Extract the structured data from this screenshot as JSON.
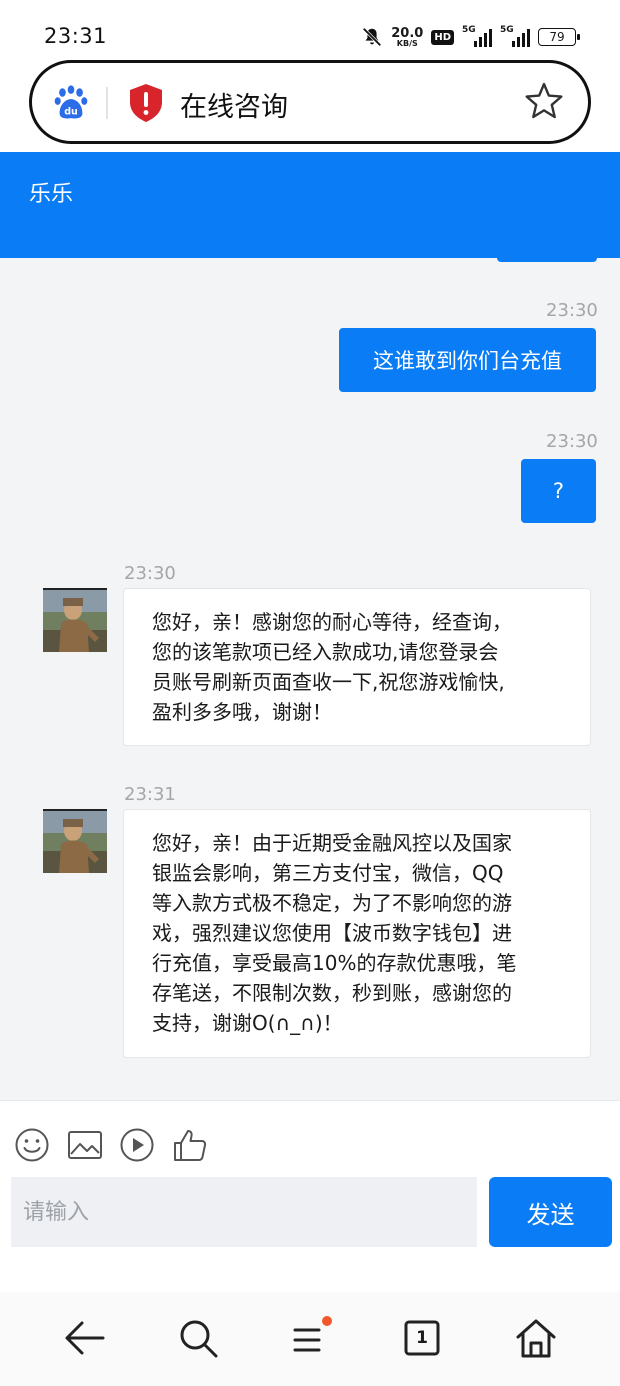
{
  "status_bar": {
    "time": "23:31",
    "net_speed": "20.0",
    "net_unit": "KB/S",
    "hd_label": "HD",
    "sig1": "5G",
    "sig2": "5G",
    "battery": "79"
  },
  "address_bar": {
    "title": "在线咨询"
  },
  "chat": {
    "title": "乐乐"
  },
  "messages": [
    {
      "side": "out",
      "time": "23:30",
      "text": "这谁敢到你们台充值"
    },
    {
      "side": "out",
      "time": "23:30",
      "text": "?"
    },
    {
      "side": "in",
      "time": "23:30",
      "lines": [
        "您好，亲！感谢您的耐心等待，经查询，",
        "您的该笔款项已经入款成功,请您登录会",
        "员账号刷新页面查收一下,祝您游戏愉快,",
        "盈利多多哦，谢谢！"
      ]
    },
    {
      "side": "in",
      "time": "23:31",
      "lines": [
        "您好，亲！由于近期受金融风控以及国家",
        "银监会影响，第三方支付宝，微信，QQ",
        "等入款方式极不稳定，为了不影响您的游",
        "戏，强烈建议您使用【波币数字钱包】进",
        "行充值，享受最高10%的存款优惠哦，笔",
        "存笔送，不限制次数，秒到账，感谢您的",
        "支持，谢谢O(∩_∩)！"
      ]
    }
  ],
  "input": {
    "placeholder": "请输入",
    "send_label": "发送"
  },
  "bottom_nav": {
    "tab_count": "1"
  },
  "colors": {
    "accent": "#0a7cf5",
    "badge": "#f2572b",
    "shield": "#d7252b"
  },
  "icons": [
    "baidu-logo-icon",
    "shield-alert-icon",
    "star-icon",
    "emoji-icon",
    "image-icon",
    "video-icon",
    "thumbs-up-icon",
    "back-arrow-icon",
    "search-icon",
    "menu-icon",
    "tabs-icon",
    "home-icon"
  ]
}
